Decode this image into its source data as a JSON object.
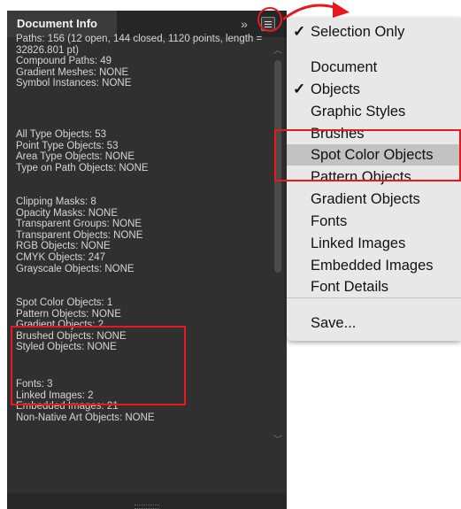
{
  "panel": {
    "title": "Document Info",
    "collapse_icon": "»",
    "colors": {
      "background": "#303030",
      "tabbar": "#262626",
      "text": "#d6d6d6",
      "highlight": "#e8191d"
    },
    "groups": [
      {
        "lines": [
          "Paths: 156 (12 open, 144 closed, 1120 points, length = 32826.801 pt)",
          "Compound Paths: 49",
          "Gradient Meshes: NONE",
          "Symbol Instances: NONE"
        ]
      },
      {
        "lines": [
          "All Type Objects: 53",
          "Point Type Objects: 53",
          "Area Type Objects: NONE",
          "Type on Path Objects: NONE"
        ]
      },
      {
        "lines": [
          "Clipping Masks: 8",
          "Opacity Masks: NONE",
          "Transparent Groups: NONE",
          "Transparent Objects: NONE",
          "RGB Objects: NONE",
          "CMYK Objects: 247",
          "Grayscale Objects: NONE"
        ]
      },
      {
        "lines": [
          "Spot Color Objects: 1",
          "Pattern Objects: NONE",
          "Gradient Objects: 2",
          "Brushed Objects: NONE",
          "Styled Objects: NONE"
        ]
      },
      {
        "lines": [
          "Fonts: 3",
          "Linked Images: 2",
          "Embedded Images: 21",
          "Non-Native Art Objects: NONE"
        ]
      }
    ]
  },
  "menu": {
    "colors": {
      "background": "#e8e8e8",
      "hover": "#c2c2c2"
    },
    "checkmark": "✓",
    "items": [
      {
        "label": "Selection Only",
        "checked": true
      },
      {
        "label": "Document",
        "checked": false
      },
      {
        "label": "Objects",
        "checked": true
      },
      {
        "label": "Graphic Styles",
        "checked": false
      },
      {
        "label": "Brushes",
        "checked": false
      },
      {
        "label": "Spot Color Objects",
        "checked": false,
        "highlighted": true
      },
      {
        "label": "Pattern Objects",
        "checked": false
      },
      {
        "label": "Gradient Objects",
        "checked": false
      },
      {
        "label": "Fonts",
        "checked": false
      },
      {
        "label": "Linked Images",
        "checked": false
      },
      {
        "label": "Embedded Images",
        "checked": false
      },
      {
        "label": "Font Details",
        "checked": false
      },
      {
        "label": "Save...",
        "checked": false
      }
    ]
  }
}
